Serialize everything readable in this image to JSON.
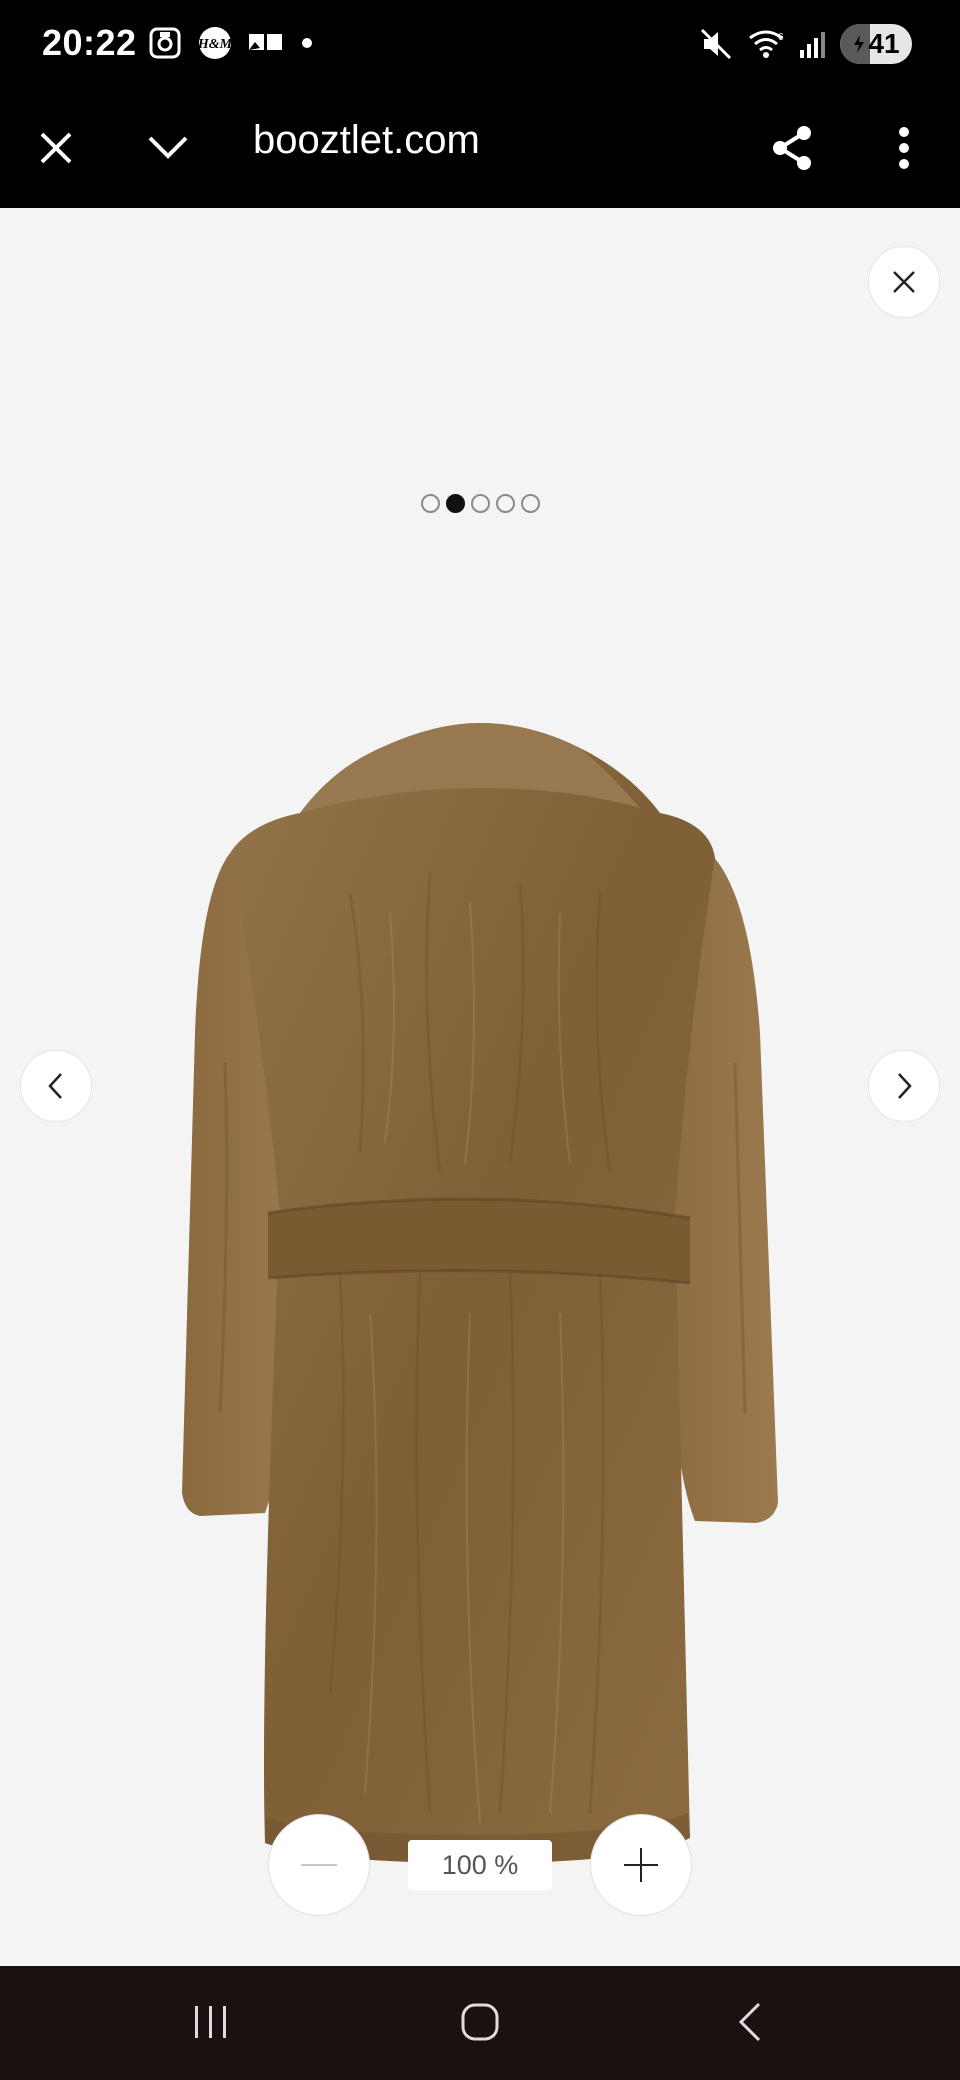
{
  "status_bar": {
    "time": "20:22",
    "battery": "41",
    "icons": [
      "screenshot-icon",
      "hm-app-icon",
      "gallery-icon",
      "dot-icon",
      "mute-icon",
      "wifi-icon",
      "signal-icon",
      "battery-icon"
    ]
  },
  "toolbar": {
    "url": "booztlet.com",
    "icons": [
      "close-icon",
      "chevron-down-icon",
      "share-icon",
      "more-vert-icon"
    ]
  },
  "gallery": {
    "dots_total": 5,
    "active_index": 1,
    "image_alt": "Brown faux fur belted coat, back view"
  },
  "zoom": {
    "level": "100 %"
  },
  "colors": {
    "bar_bg": "#000000",
    "viewer_bg": "#f4f4f4",
    "coat": "#8a6a3e",
    "nav_bg": "#1a1110"
  }
}
